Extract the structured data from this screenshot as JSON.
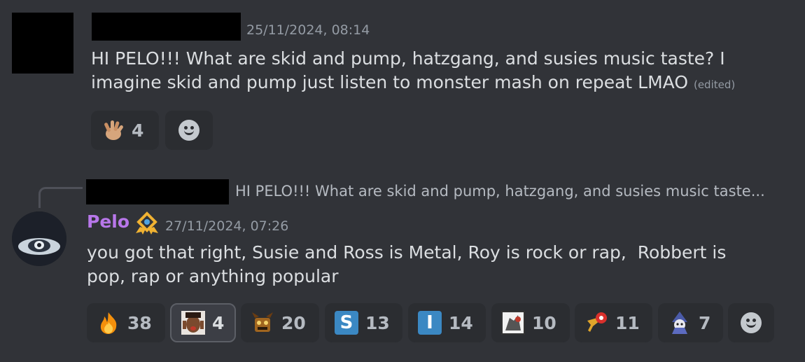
{
  "message1": {
    "timestamp": "25/11/2024, 08:14",
    "text_line1": "HI PELO!!! What are skid and pump, hatzgang, and susies music taste? I",
    "text_line2": "imagine skid and pump just listen to monster mash on repeat LMAO",
    "edited_label": "(edited)",
    "reactions": [
      {
        "emoji": "hand-emoji",
        "count": "4"
      }
    ]
  },
  "reply": {
    "preview_text": "HI PELO!!! What are skid and pump, hatzgang, and susies music taste..."
  },
  "message2": {
    "author": "Pelo",
    "author_color": "#b877ea",
    "badge_icon": "role-badge-icon",
    "timestamp": "27/11/2024, 07:26",
    "text_line1": "you got that right, Susie and Ross is Metal, Roy is rock or rap,  Robbert is",
    "text_line2": "pop, rap or anything popular",
    "reactions": [
      {
        "emoji": "fire-emoji",
        "count": "38"
      },
      {
        "emoji": "face-emoji",
        "count": "4",
        "selected": true
      },
      {
        "emoji": "character-emoji",
        "count": "20"
      },
      {
        "emoji": "letter-s-emoji",
        "glyph": "S",
        "count": "13"
      },
      {
        "emoji": "letter-i-emoji",
        "glyph": "I",
        "count": "14"
      },
      {
        "emoji": "comic-emoji",
        "count": "10"
      },
      {
        "emoji": "saxophone-emoji",
        "count": "11"
      },
      {
        "emoji": "wizard-emoji",
        "count": "7"
      }
    ]
  },
  "colors": {
    "background": "#313338",
    "reaction_bg": "#2b2d31",
    "username": "#b877ea",
    "timestamp": "#949ba4",
    "letter_emoji_blue": "#3b88c3"
  }
}
